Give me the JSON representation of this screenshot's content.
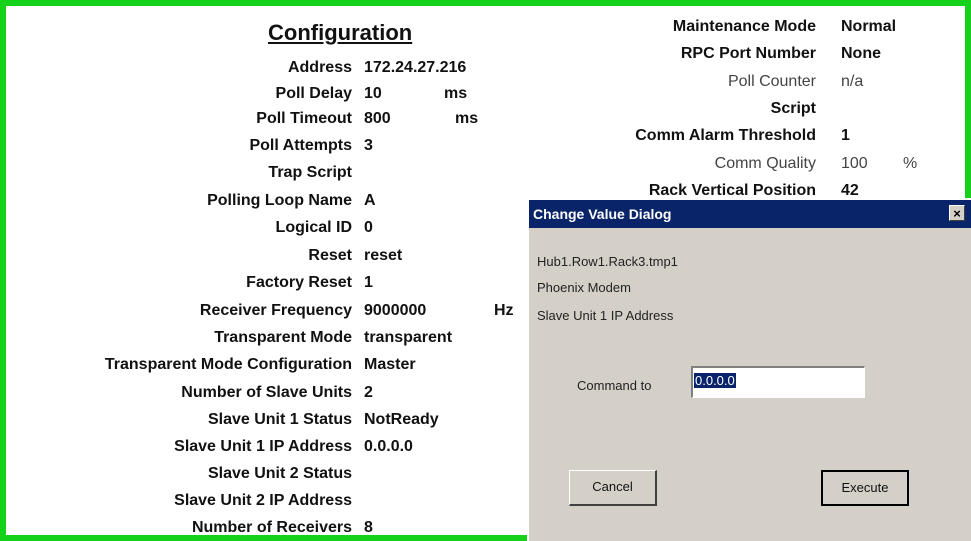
{
  "configuration": {
    "title": "Configuration",
    "rows": [
      {
        "label": "Address",
        "value": "172.24.27.216",
        "unit": ""
      },
      {
        "label": "Poll Delay",
        "value": "10",
        "unit": "ms"
      },
      {
        "label": "Poll Timeout",
        "value": "800",
        "unit": "ms"
      },
      {
        "label": "Poll Attempts",
        "value": "3",
        "unit": ""
      },
      {
        "label": "Trap Script",
        "value": "",
        "unit": ""
      },
      {
        "label": "Polling Loop Name",
        "value": "A",
        "unit": ""
      },
      {
        "label": "Logical ID",
        "value": "0",
        "unit": ""
      },
      {
        "label": "Reset",
        "value": "reset",
        "unit": ""
      },
      {
        "label": "Factory Reset",
        "value": "1",
        "unit": ""
      },
      {
        "label": "Receiver Frequency",
        "value": "9000000",
        "unit": "Hz"
      },
      {
        "label": "Transparent Mode",
        "value": "transparent",
        "unit": ""
      },
      {
        "label": "Transparent Mode Configuration",
        "value": "Master",
        "unit": ""
      },
      {
        "label": "Number of Slave Units",
        "value": "2",
        "unit": ""
      },
      {
        "label": "Slave Unit 1 Status",
        "value": "NotReady",
        "unit": ""
      },
      {
        "label": "Slave Unit 1 IP Address",
        "value": "0.0.0.0",
        "unit": ""
      },
      {
        "label": "Slave Unit 2 Status",
        "value": "",
        "unit": ""
      },
      {
        "label": "Slave Unit 2 IP Address",
        "value": "",
        "unit": ""
      },
      {
        "label": "Number of Receivers",
        "value": "8",
        "unit": ""
      }
    ]
  },
  "right_panel": {
    "rows": [
      {
        "label": "Maintenance Mode",
        "value": "Normal",
        "unit": ""
      },
      {
        "label": "RPC Port Number",
        "value": "None",
        "unit": ""
      },
      {
        "label": "Poll Counter",
        "value": "n/a",
        "unit": ""
      },
      {
        "label": "Script",
        "value": "",
        "unit": ""
      },
      {
        "label": "Comm Alarm Threshold",
        "value": "1",
        "unit": ""
      },
      {
        "label": "Comm Quality",
        "value": "100",
        "unit": "%"
      },
      {
        "label": "Rack Vertical Position",
        "value": "42",
        "unit": ""
      }
    ]
  },
  "dialog": {
    "title": "Change Value Dialog",
    "close_label": "×",
    "path": "Hub1.Row1.Rack3.tmp1",
    "device": "Phoenix Modem",
    "field": "Slave Unit 1 IP Address",
    "command_label": "Command to",
    "command_value": "0.0.0.0",
    "cancel_label": "Cancel",
    "execute_label": "Execute"
  }
}
